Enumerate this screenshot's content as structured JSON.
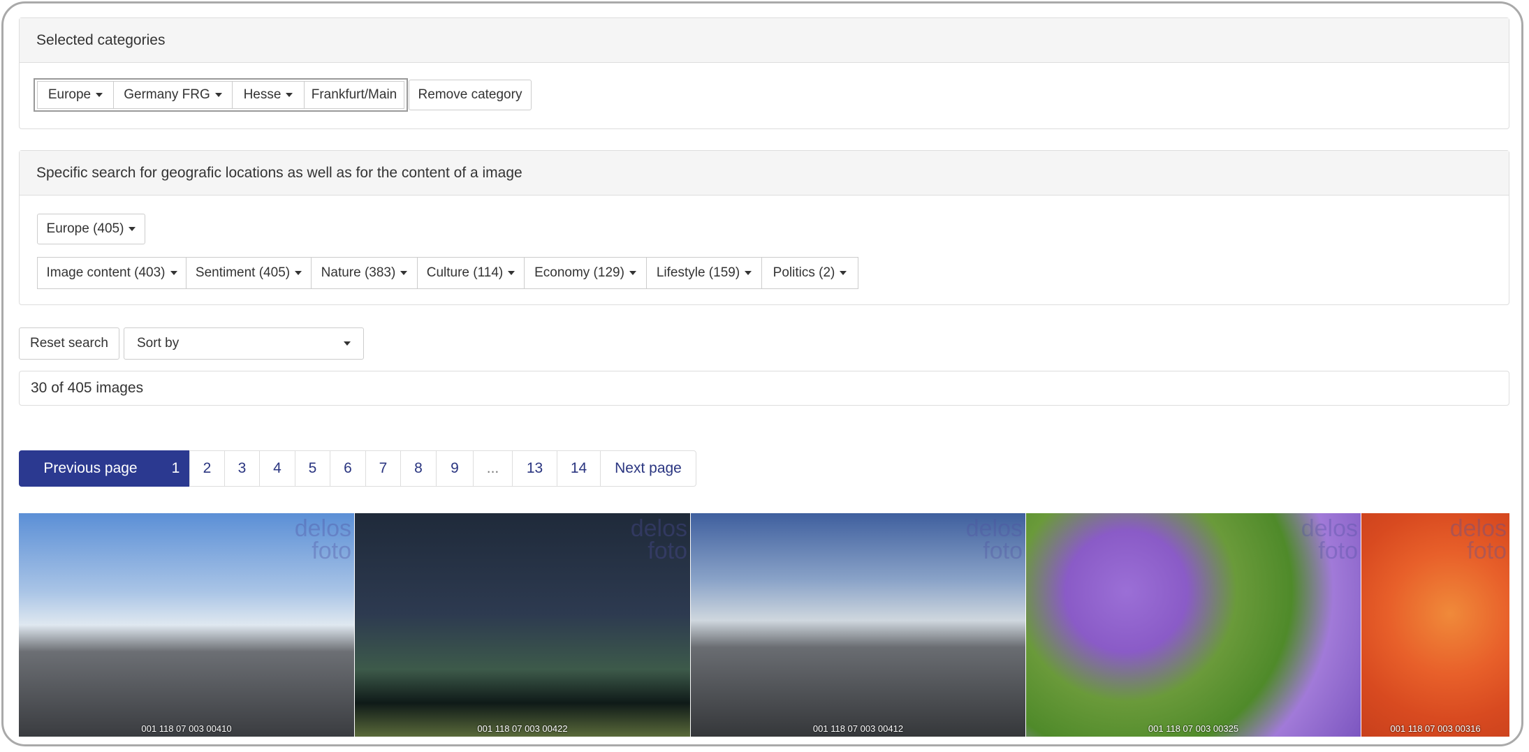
{
  "selected_categories": {
    "title": "Selected categories",
    "crumbs": [
      "Europe",
      "Germany FRG",
      "Hesse",
      "Frankfurt/Main"
    ],
    "remove_label": "Remove category"
  },
  "specific_search": {
    "title": "Specific search for geografic locations as well as for the content of a image",
    "region": "Europe (405)",
    "filters": [
      "Image content (403)",
      "Sentiment (405)",
      "Nature (383)",
      "Culture (114)",
      "Economy (129)",
      "Lifestyle (159)",
      "Politics (2)"
    ]
  },
  "toolbar": {
    "reset_label": "Reset search",
    "sort_label": "Sort by"
  },
  "results": {
    "count_text": "30 of 405 images"
  },
  "pager": {
    "prev": "Previous page",
    "pages": [
      "1",
      "2",
      "3",
      "4",
      "5",
      "6",
      "7",
      "8",
      "9",
      "...",
      "13",
      "14"
    ],
    "next": "Next page",
    "active": "1"
  },
  "thumbnails": [
    {
      "id": "001 118 07 003 00410",
      "watermark": "delos foto"
    },
    {
      "id": "001 118 07 003 00422",
      "watermark": "delos foto"
    },
    {
      "id": "001 118 07 003 00412",
      "watermark": "delos foto"
    },
    {
      "id": "001 118 07 003 00325",
      "watermark": "delos foto"
    },
    {
      "id": "001 118 07 003 00316",
      "watermark": "delos foto"
    }
  ],
  "colors": {
    "primary": "#2b3990",
    "panel_bg": "#f5f5f5",
    "border": "#dddddd"
  }
}
